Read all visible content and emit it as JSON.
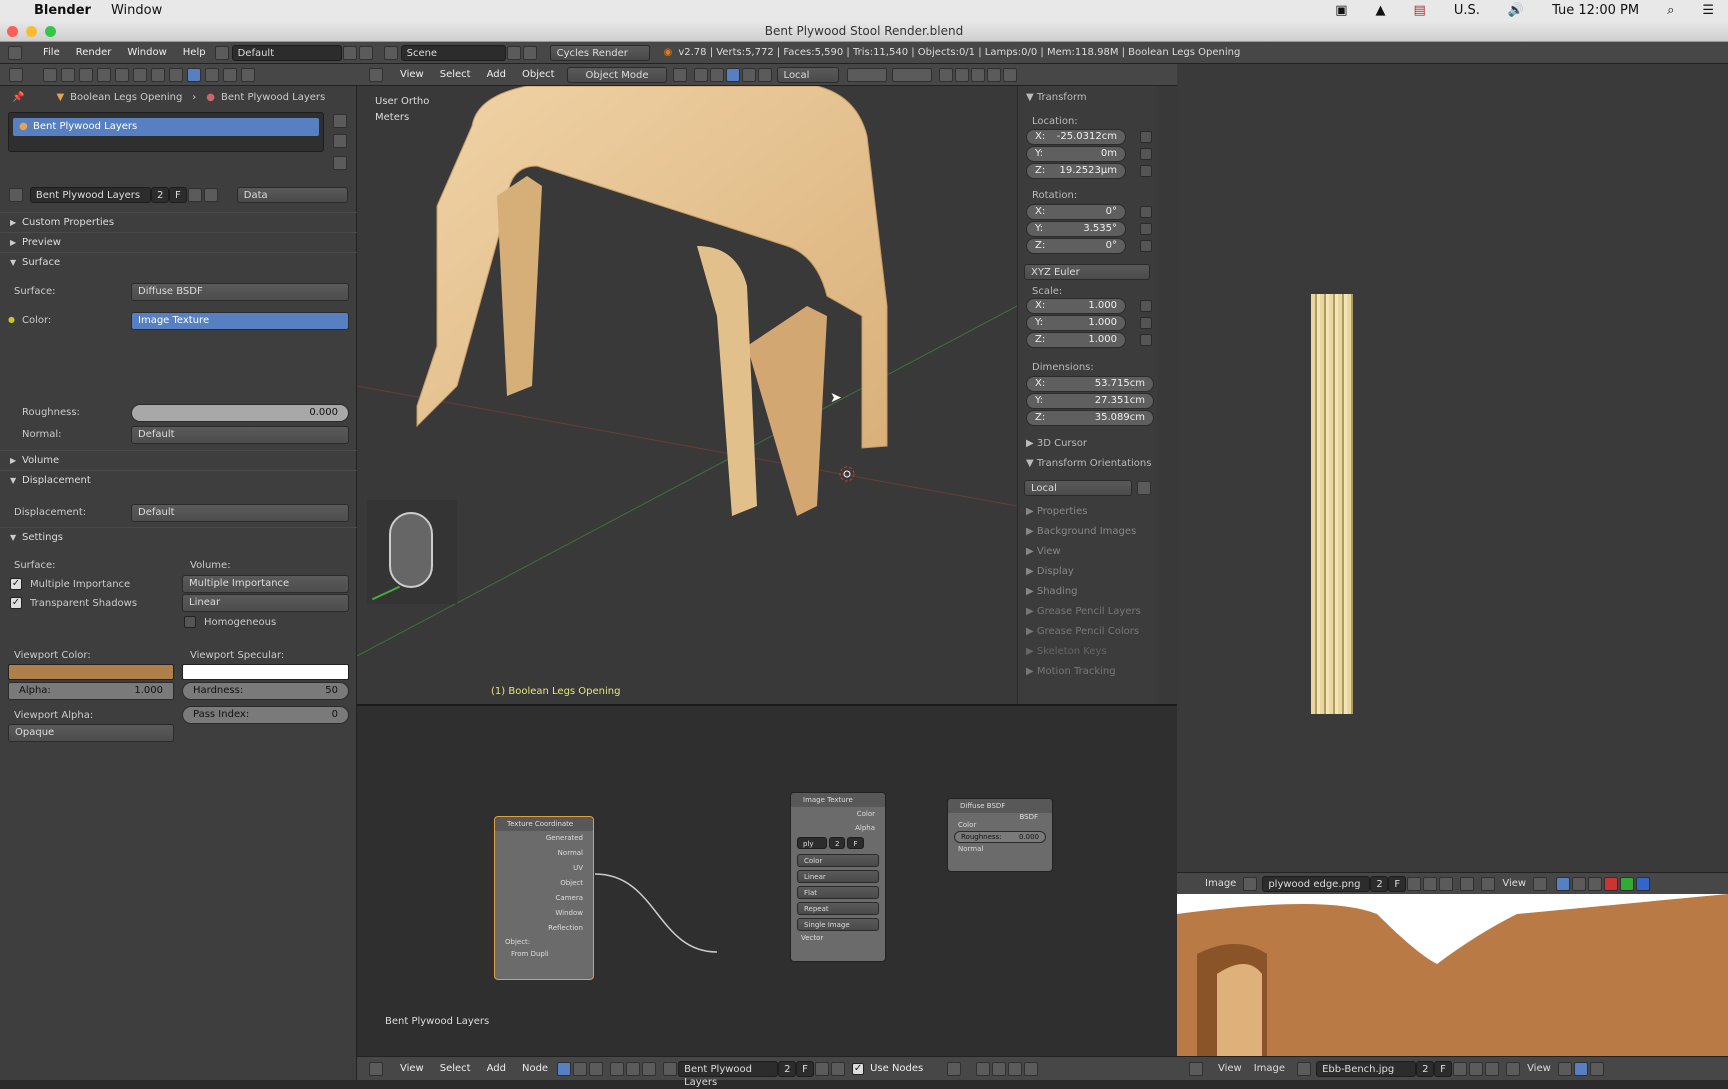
{
  "macos": {
    "app_name": "Blender",
    "menu": [
      "Window"
    ],
    "status": [
      "U.S."
    ],
    "clock": "Tue 12:00 PM"
  },
  "window": {
    "title": "Bent Plywood Stool Render.blend"
  },
  "info_bar": {
    "menus": [
      "File",
      "Render",
      "Window",
      "Help"
    ],
    "layout": "Default",
    "scene": "Scene",
    "engine": "Cycles Render",
    "stats": "v2.78 | Verts:5,772 | Faces:5,590 | Tris:11,540 | Objects:0/1 | Lamps:0/0 | Mem:118.98M | Boolean Legs Opening"
  },
  "properties": {
    "breadcrumb": [
      "Boolean Legs Opening",
      "Bent Plywood Layers"
    ],
    "material_slot": "Bent Plywood Layers",
    "material_name": "Bent Plywood Layers",
    "user_count": "2",
    "fake_user": "F",
    "link": "Data",
    "panels": {
      "custom_properties": "Custom Properties",
      "preview": "Preview",
      "surface": "Surface",
      "volume": "Volume",
      "displacement": "Displacement",
      "settings": "Settings"
    },
    "surface": {
      "surface_label": "Surface:",
      "surface_value": "Diffuse BSDF",
      "color_label": "Color:",
      "color_value": "Image Texture",
      "roughness_label": "Roughness:",
      "roughness_value": "0.000",
      "normal_label": "Normal:",
      "normal_value": "Default"
    },
    "displacement": {
      "label": "Displacement:",
      "value": "Default"
    },
    "settings": {
      "surface_label": "Surface:",
      "volume_label": "Volume:",
      "multiple_importance": "Multiple Importance",
      "transparent_shadows": "Transparent Shadows",
      "volume_sampling": "Multiple Importance",
      "volume_interp": "Linear",
      "homogeneous": "Homogeneous",
      "viewport_color_label": "Viewport Color:",
      "viewport_specular_label": "Viewport Specular:",
      "alpha_label": "Alpha:",
      "alpha_value": "1.000",
      "hardness_label": "Hardness:",
      "hardness_value": "50",
      "viewport_alpha_label": "Viewport Alpha:",
      "pass_index_label": "Pass Index:",
      "pass_index_value": "0",
      "blend_mode": "Opaque",
      "viewport_color": "#b0804a",
      "viewport_specular": "#ffffff"
    }
  },
  "viewport": {
    "menus": [
      "View",
      "Select",
      "Add",
      "Object"
    ],
    "mode": "Object Mode",
    "orientation": "Local",
    "view_name": "User Ortho",
    "units": "Meters",
    "object_label": "(1) Boolean Legs Opening"
  },
  "npanel": {
    "transform": "Transform",
    "location_label": "Location:",
    "location": {
      "x": "-25.0312cm",
      "y": "0m",
      "z": "19.2523µm"
    },
    "rotation_label": "Rotation:",
    "rotation": {
      "x": "0°",
      "y": "3.535°",
      "z": "0°"
    },
    "rotation_mode": "XYZ Euler",
    "scale_label": "Scale:",
    "scale": {
      "x": "1.000",
      "y": "1.000",
      "z": "1.000"
    },
    "dimensions_label": "Dimensions:",
    "dimensions": {
      "x": "53.715cm",
      "y": "27.351cm",
      "z": "35.089cm"
    },
    "cursor": "3D Cursor",
    "transform_orient": "Transform Orientations",
    "orient_value": "Local",
    "panels": [
      "Properties",
      "Background Images",
      "View",
      "Display",
      "Shading",
      "Grease Pencil Layers",
      "Grease Pencil Colors",
      "Skeleton Keys",
      "Motion Tracking"
    ]
  },
  "nodes": {
    "texcoord": {
      "title": "Texture Coordinate",
      "outputs": [
        "Generated",
        "Normal",
        "UV",
        "Object",
        "Camera",
        "Window",
        "Reflection"
      ],
      "object": "Object:",
      "from_dupli": "From Dupli"
    },
    "image": {
      "title": "Image Texture",
      "outputs": [
        "Color",
        "Alpha"
      ],
      "image_name": "ply",
      "users": "2",
      "fake": "F",
      "options": [
        "Color",
        "Linear",
        "Flat",
        "Repeat",
        "Single Image"
      ],
      "vector": "Vector"
    },
    "diffuse": {
      "title": "Diffuse BSDF",
      "output": "BSDF",
      "color": "Color",
      "roughness_label": "Roughness:",
      "roughness_value": "0.000",
      "normal": "Normal"
    }
  },
  "node_editor": {
    "material_label": "Bent Plywood Layers",
    "menus": [
      "View",
      "Select",
      "Add",
      "Node"
    ],
    "material": "Bent Plywood Layers",
    "users": "2",
    "fake": "F",
    "use_nodes": "Use Nodes"
  },
  "image_editor": {
    "menus": [
      "View",
      "Image"
    ],
    "label": "Image",
    "image": "plywood edge.png",
    "users": "2",
    "fake": "F",
    "view": "View"
  },
  "image_editor2": {
    "menus": [
      "View",
      "Image"
    ],
    "image": "Ebb-Bench.jpg",
    "users": "2",
    "fake": "F",
    "view": "View"
  }
}
